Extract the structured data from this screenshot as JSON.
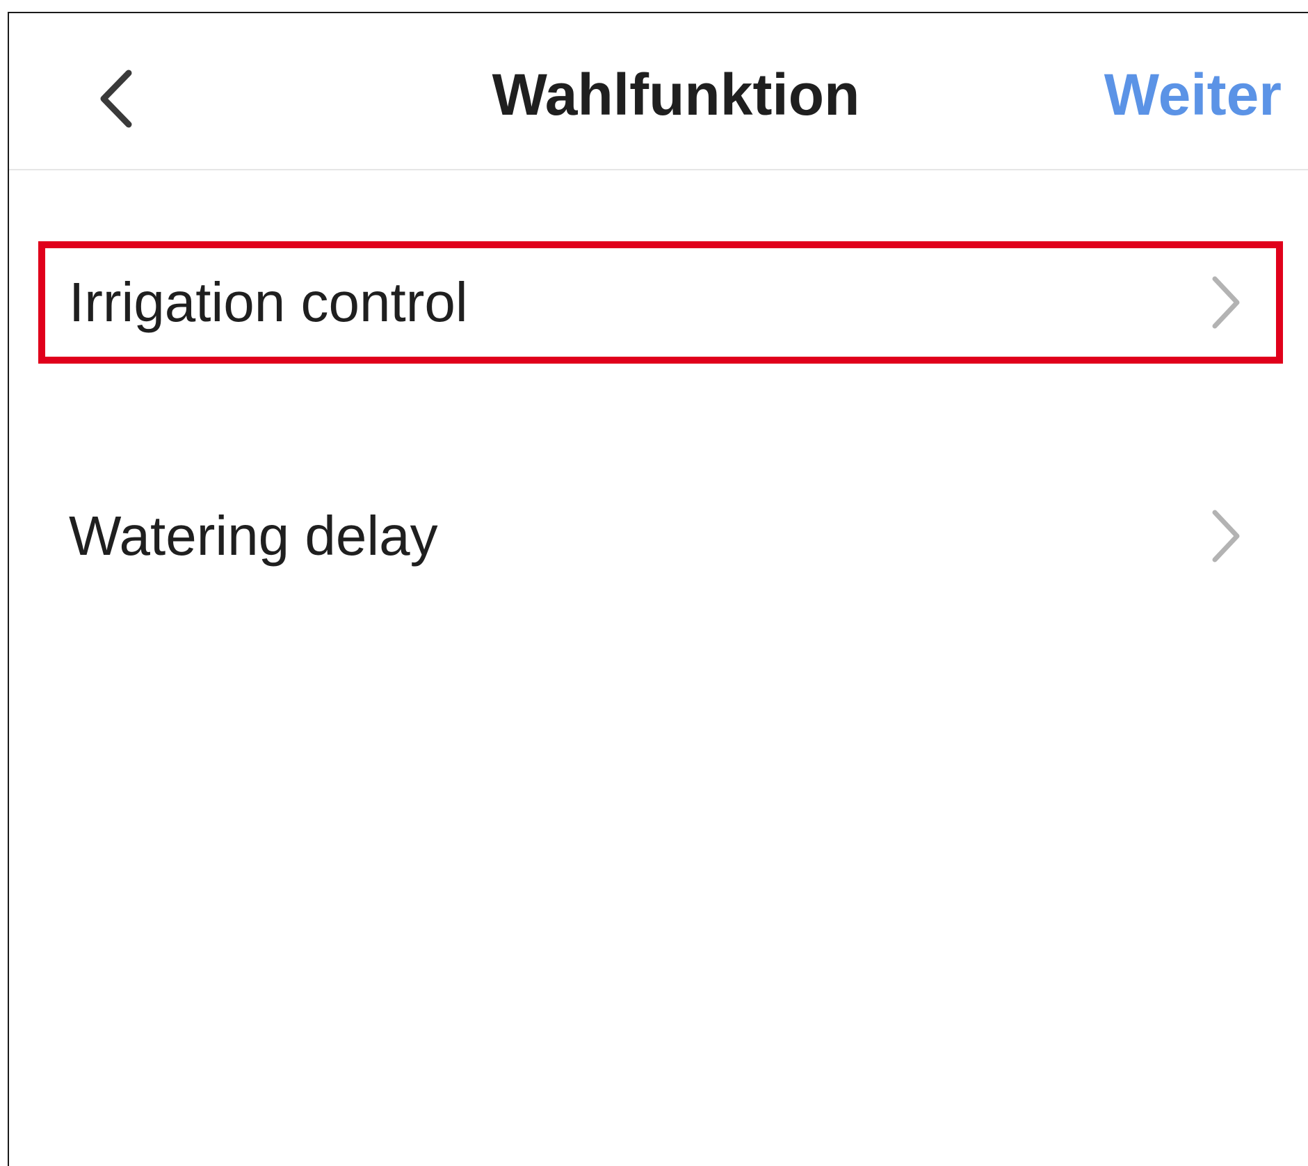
{
  "nav_bar": {
    "back_icon": "chevron-left-icon",
    "title": "Wahlfunktion",
    "next_label": "Weiter"
  },
  "colors": {
    "accent": "#5b93e6",
    "highlight_border": "#e0001b",
    "text": "#1f1f1f",
    "chevron": "#b3b3b3",
    "divider": "#e6e6e6"
  },
  "list": {
    "items": [
      {
        "label": "Irrigation control",
        "icon": "chevron-right-icon",
        "highlighted": true
      },
      {
        "label": "Watering delay",
        "icon": "chevron-right-icon",
        "highlighted": false
      }
    ]
  }
}
